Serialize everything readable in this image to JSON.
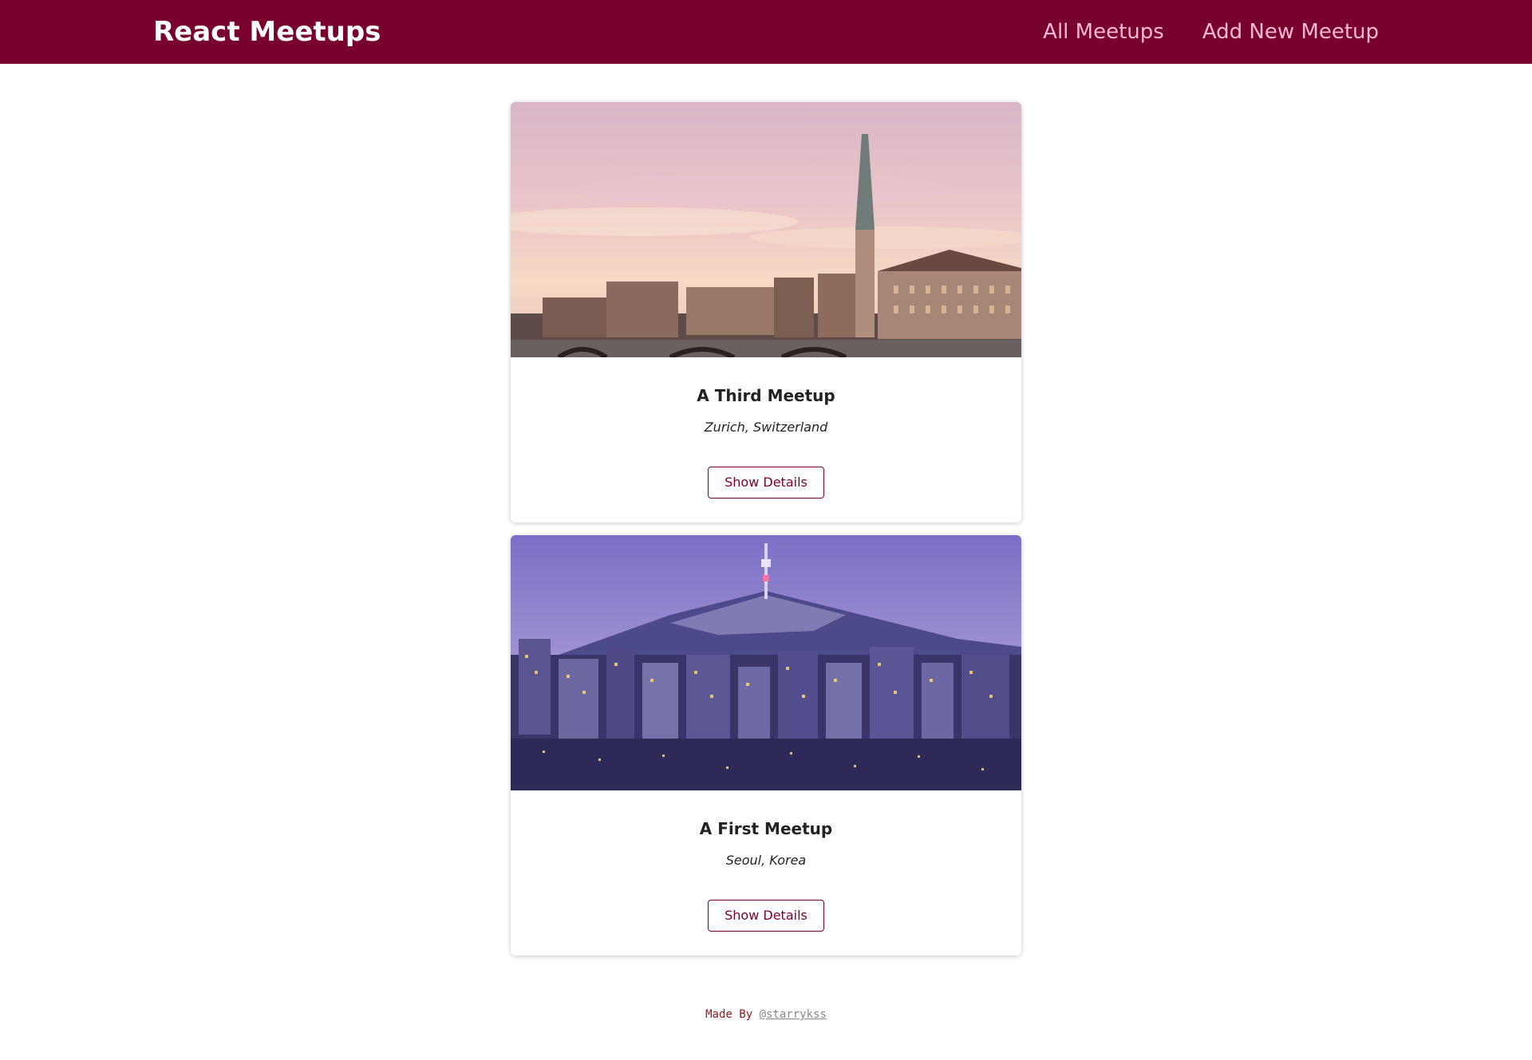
{
  "header": {
    "title": "React Meetups",
    "nav": [
      {
        "label": "All Meetups"
      },
      {
        "label": "Add New Meetup"
      }
    ],
    "colors": {
      "background": "#77002e",
      "nav_text": "#fcb8d2"
    }
  },
  "meetups": [
    {
      "title": "A Third Meetup",
      "address": "Zurich, Switzerland",
      "button": "Show Details",
      "image": "zurich-cityscape-photo"
    },
    {
      "title": "A First Meetup",
      "address": "Seoul, Korea",
      "button": "Show Details",
      "image": "seoul-cityscape-photo"
    }
  ],
  "footer": {
    "prefix": "Made By",
    "handle": "@starrykss"
  }
}
